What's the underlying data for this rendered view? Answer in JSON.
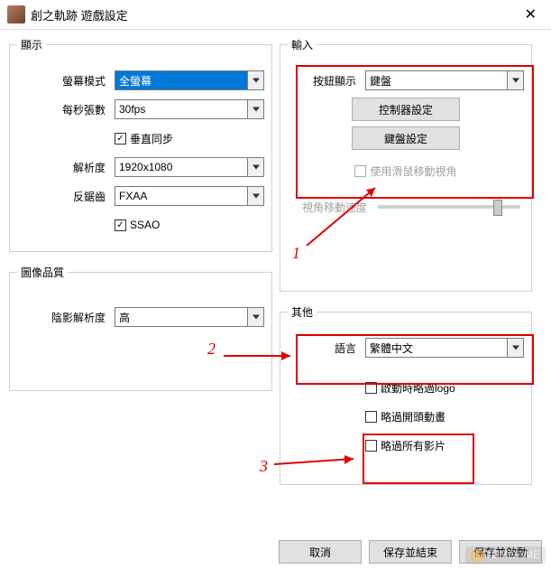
{
  "window": {
    "title": "創之軌跡 遊戲設定"
  },
  "display": {
    "legend": "顯示",
    "screen_mode_label": "螢幕模式",
    "screen_mode_value": "全螢幕",
    "fps_label": "每秒張數",
    "fps_value": "30fps",
    "vsync_label": "垂直同步",
    "resolution_label": "解析度",
    "resolution_value": "1920x1080",
    "aa_label": "反鋸齒",
    "aa_value": "FXAA",
    "ssao_label": "SSAO"
  },
  "quality": {
    "legend": "圖像品質",
    "shadow_label": "陰影解析度",
    "shadow_value": "高"
  },
  "input": {
    "legend": "輸入",
    "button_display_label": "按鈕顯示",
    "button_display_value": "鍵盤",
    "controller_settings": "控制器設定",
    "keyboard_settings": "鍵盤設定",
    "mouse_look_label": "使用滑鼠移動視角",
    "view_speed_label": "視角移動速度"
  },
  "other": {
    "legend": "其他",
    "language_label": "語言",
    "language_value": "繁體中文",
    "skip_logo_label": "啟動時略過logo",
    "skip_opening_label": "略過開頭動畫",
    "skip_videos_label": "略過所有影片"
  },
  "footer": {
    "cancel": "取消",
    "save_exit": "保存並結束",
    "save_launch": "保存並啟動"
  },
  "annotations": {
    "n1": "1",
    "n2": "2",
    "n3": "3"
  },
  "watermark": "3DMGAME"
}
